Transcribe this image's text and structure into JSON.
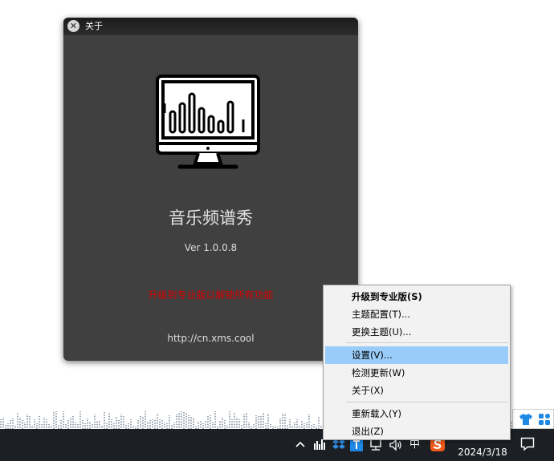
{
  "about_window": {
    "title": "关于",
    "app_name": "音乐频谱秀",
    "version": "Ver 1.0.0.8",
    "upgrade_text": "升级到专业版以解锁所有功能",
    "url": "http://cn.xms.cool"
  },
  "context_menu": {
    "items": [
      {
        "label": "升级到专业版(S)",
        "bold": true
      },
      {
        "label": "主题配置(T)..."
      },
      {
        "label": "更换主题(U)..."
      },
      {
        "label": "设置(V)...",
        "highlighted": true
      },
      {
        "label": "检测更新(W)"
      },
      {
        "label": "关于(X)"
      },
      {
        "label": "重新载入(Y)"
      },
      {
        "label": "退出(Z)"
      }
    ]
  },
  "taskbar": {
    "ime_label": "中",
    "date": "2024/3/18"
  },
  "colors": {
    "window_bg": "#404040",
    "upgrade_red": "#d80000",
    "menu_highlight": "#99ccf8",
    "taskbar_bg": "#1c2024",
    "tray_blue": "#1e88e5"
  },
  "icons": [
    "close-icon",
    "spectrum-monitor-icon",
    "tshirt-icon",
    "grid-icon",
    "chevron-up-icon",
    "spectrum-tray-icon",
    "dropbox-icon",
    "blue-app-icon",
    "network-icon",
    "volume-icon",
    "sogou-icon",
    "notification-icon"
  ]
}
